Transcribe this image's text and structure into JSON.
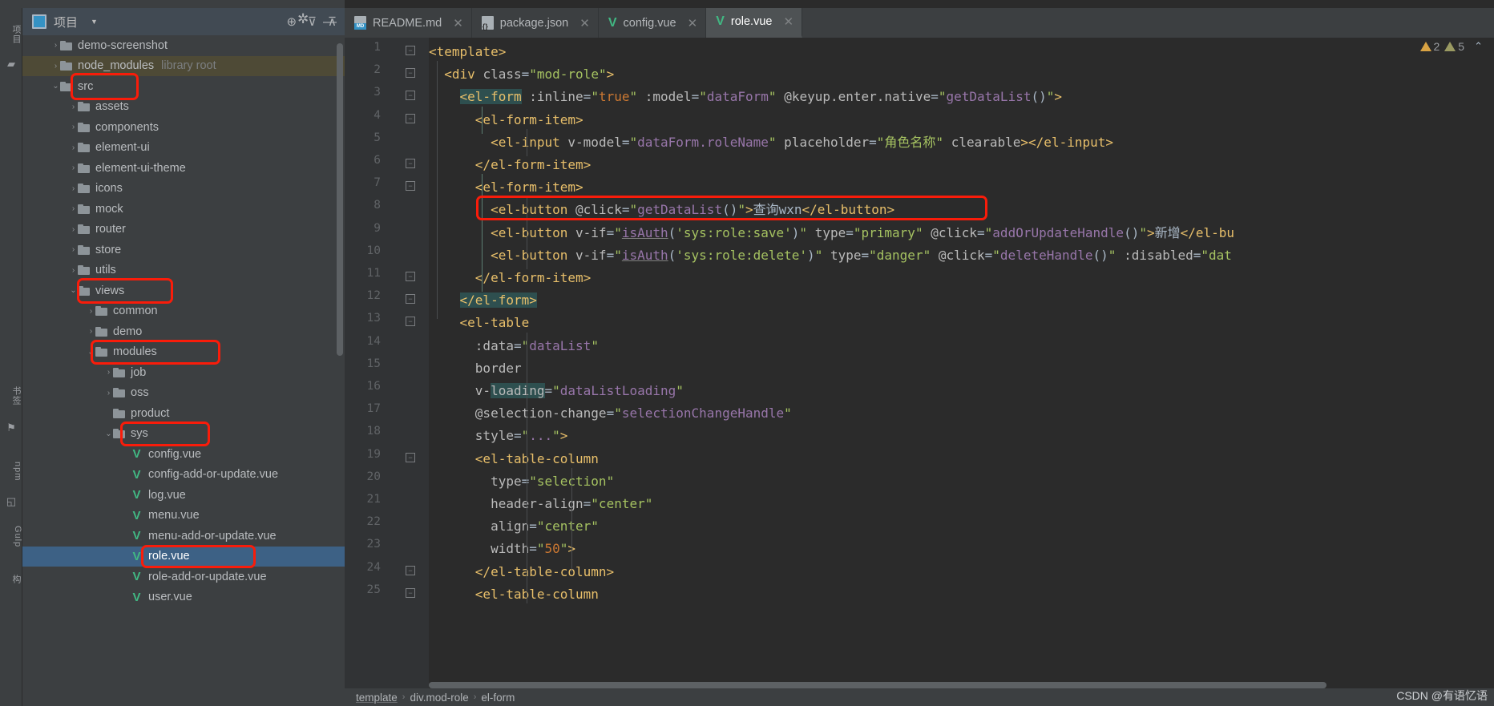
{
  "window": {
    "title": "role.vue"
  },
  "left_rail": {
    "items": [
      {
        "name": "rail-project",
        "label": "项目",
        "type": "text"
      },
      {
        "name": "rail-structure-folder",
        "label": "",
        "type": "icon",
        "icon": "folder-icon"
      },
      {
        "name": "rail-bookmarks",
        "label": "书签",
        "type": "text"
      },
      {
        "name": "rail-bookmark-icon",
        "label": "",
        "type": "icon",
        "icon": "bookmark-icon"
      },
      {
        "name": "rail-npm",
        "label": "npm",
        "type": "text"
      },
      {
        "name": "rail-terminal-icon",
        "label": "",
        "type": "icon",
        "icon": "terminal-icon"
      },
      {
        "name": "rail-gulp",
        "label": "Gulp",
        "type": "text"
      },
      {
        "name": "rail-structure",
        "label": "构",
        "type": "text"
      }
    ]
  },
  "project_panel": {
    "header": {
      "title": "项目",
      "caret": "▼",
      "tools": [
        {
          "name": "locate-icon",
          "glyph": "⊕"
        },
        {
          "name": "expand-all-icon",
          "glyph": "⊽"
        },
        {
          "name": "collapse-all-icon",
          "glyph": "⊼"
        },
        {
          "name": "settings-gear-icon",
          "glyph": "✿"
        },
        {
          "name": "minimize-icon",
          "glyph": "—"
        }
      ]
    },
    "tree": [
      {
        "label": "demo-screenshot",
        "type": "folder",
        "indent": 1,
        "arrow": "›",
        "sub": "",
        "state": "collapsed"
      },
      {
        "label": "node_modules",
        "type": "folder",
        "indent": 1,
        "arrow": "›",
        "sub": "library root",
        "state": "library"
      },
      {
        "label": "src",
        "type": "folder",
        "indent": 1,
        "arrow": "⌄",
        "sub": "",
        "state": "expanded"
      },
      {
        "label": "assets",
        "type": "folder",
        "indent": 2,
        "arrow": "›",
        "sub": "",
        "state": "collapsed"
      },
      {
        "label": "components",
        "type": "folder",
        "indent": 2,
        "arrow": "›",
        "sub": "",
        "state": "collapsed"
      },
      {
        "label": "element-ui",
        "type": "folder",
        "indent": 2,
        "arrow": "›",
        "sub": "",
        "state": "collapsed"
      },
      {
        "label": "element-ui-theme",
        "type": "folder",
        "indent": 2,
        "arrow": "›",
        "sub": "",
        "state": "collapsed"
      },
      {
        "label": "icons",
        "type": "folder",
        "indent": 2,
        "arrow": "›",
        "sub": "",
        "state": "collapsed"
      },
      {
        "label": "mock",
        "type": "folder",
        "indent": 2,
        "arrow": "›",
        "sub": "",
        "state": "collapsed"
      },
      {
        "label": "router",
        "type": "folder",
        "indent": 2,
        "arrow": "›",
        "sub": "",
        "state": "collapsed"
      },
      {
        "label": "store",
        "type": "folder",
        "indent": 2,
        "arrow": "›",
        "sub": "",
        "state": "collapsed"
      },
      {
        "label": "utils",
        "type": "folder",
        "indent": 2,
        "arrow": "›",
        "sub": "",
        "state": "collapsed"
      },
      {
        "label": "views",
        "type": "folder",
        "indent": 2,
        "arrow": "⌄",
        "sub": "",
        "state": "expanded"
      },
      {
        "label": "common",
        "type": "folder",
        "indent": 3,
        "arrow": "›",
        "sub": "",
        "state": "collapsed"
      },
      {
        "label": "demo",
        "type": "folder",
        "indent": 3,
        "arrow": "›",
        "sub": "",
        "state": "collapsed"
      },
      {
        "label": "modules",
        "type": "folder",
        "indent": 3,
        "arrow": "⌄",
        "sub": "",
        "state": "expanded"
      },
      {
        "label": "job",
        "type": "folder",
        "indent": 4,
        "arrow": "›",
        "sub": "",
        "state": "collapsed"
      },
      {
        "label": "oss",
        "type": "folder",
        "indent": 4,
        "arrow": "›",
        "sub": "",
        "state": "collapsed"
      },
      {
        "label": "product",
        "type": "folder",
        "indent": 4,
        "arrow": "",
        "sub": "",
        "state": "leaf"
      },
      {
        "label": "sys",
        "type": "folder",
        "indent": 4,
        "arrow": "⌄",
        "sub": "",
        "state": "expanded"
      },
      {
        "label": "config.vue",
        "type": "vue",
        "indent": 5,
        "arrow": "",
        "sub": "",
        "state": "file"
      },
      {
        "label": "config-add-or-update.vue",
        "type": "vue",
        "indent": 5,
        "arrow": "",
        "sub": "",
        "state": "file"
      },
      {
        "label": "log.vue",
        "type": "vue",
        "indent": 5,
        "arrow": "",
        "sub": "",
        "state": "file"
      },
      {
        "label": "menu.vue",
        "type": "vue",
        "indent": 5,
        "arrow": "",
        "sub": "",
        "state": "file"
      },
      {
        "label": "menu-add-or-update.vue",
        "type": "vue",
        "indent": 5,
        "arrow": "",
        "sub": "",
        "state": "file"
      },
      {
        "label": "role.vue",
        "type": "vue",
        "indent": 5,
        "arrow": "",
        "sub": "",
        "state": "selected"
      },
      {
        "label": "role-add-or-update.vue",
        "type": "vue",
        "indent": 5,
        "arrow": "",
        "sub": "",
        "state": "file"
      },
      {
        "label": "user.vue",
        "type": "vue",
        "indent": 5,
        "arrow": "",
        "sub": "",
        "state": "file"
      }
    ],
    "annotations": [
      {
        "name": "annotation-src",
        "target": "src"
      },
      {
        "name": "annotation-views",
        "target": "views"
      },
      {
        "name": "annotation-modules",
        "target": "modules"
      },
      {
        "name": "annotation-sys",
        "target": "sys"
      },
      {
        "name": "annotation-role-vue",
        "target": "role.vue"
      }
    ]
  },
  "tabs": [
    {
      "label": "README.md",
      "icon": "markdown-icon",
      "active": false,
      "closable": true
    },
    {
      "label": "package.json",
      "icon": "json-icon",
      "active": false,
      "closable": true
    },
    {
      "label": "config.vue",
      "icon": "vue-icon",
      "active": false,
      "closable": true
    },
    {
      "label": "role.vue",
      "icon": "vue-icon",
      "active": true,
      "closable": true
    }
  ],
  "inspections": {
    "warnings": "2",
    "weak_warnings": "5",
    "collapse_glyph": "⌃"
  },
  "breadcrumb": [
    "template",
    "div.mod-role",
    "el-form"
  ],
  "watermark": "CSDN @有语忆语",
  "editor": {
    "annotation_line": 8,
    "lines": [
      {
        "n": 1,
        "indent": 0,
        "fold": "minus",
        "html": "<span class=\"tag\">&lt;template&gt;</span>"
      },
      {
        "n": 2,
        "indent": 1,
        "fold": "minus",
        "html": "  <span class=\"tag\">&lt;div</span> <span class=\"attr\">class</span><span class=\"punct\">=</span><span class=\"str\">\"mod-role\"</span><span class=\"tag\">&gt;</span>"
      },
      {
        "n": 3,
        "indent": 2,
        "fold": "minus",
        "html": "    <span class=\"tag hl\">&lt;el-form</span> <span class=\"attr\">:inline</span><span class=\"punct\">=</span><span class=\"str\">\"</span><span class=\"val-o\">true</span><span class=\"str\">\"</span> <span class=\"attr\">:model</span><span class=\"punct\">=</span><span class=\"str\">\"</span><span class=\"val-p\">dataForm</span><span class=\"str\">\"</span> <span class=\"attr\">@keyup.enter.native</span><span class=\"punct\">=</span><span class=\"str\">\"</span><span class=\"val-p\">getDataList</span><span class=\"punct\">()</span><span class=\"str\">\"</span><span class=\"tag\">&gt;</span>"
      },
      {
        "n": 4,
        "indent": 3,
        "fold": "minus",
        "html": "      <span class=\"tag\">&lt;el-form-item&gt;</span>"
      },
      {
        "n": 5,
        "indent": 4,
        "fold": "",
        "html": "        <span class=\"tag\">&lt;el-input</span> <span class=\"attr\">v-model</span><span class=\"punct\">=</span><span class=\"str\">\"</span><span class=\"val-p\">dataForm.roleName</span><span class=\"str\">\"</span> <span class=\"attr\">placeholder</span><span class=\"punct\">=</span><span class=\"str\">\"角色名称\"</span> <span class=\"attr\">clearable</span><span class=\"tag\">&gt;&lt;/el-input&gt;</span>"
      },
      {
        "n": 6,
        "indent": 3,
        "fold": "plus",
        "html": "      <span class=\"tag\">&lt;/el-form-item&gt;</span>"
      },
      {
        "n": 7,
        "indent": 3,
        "fold": "minus",
        "html": "      <span class=\"tag\">&lt;el-form-item&gt;</span>"
      },
      {
        "n": 8,
        "indent": 4,
        "fold": "",
        "html": "        <span class=\"tag\">&lt;el-button</span> <span class=\"attr\">@click</span><span class=\"punct\">=</span><span class=\"str\">\"</span><span class=\"val-p\">getDataList</span><span class=\"punct\">()</span><span class=\"str\">\"</span><span class=\"tag\">&gt;</span><span class=\"punct\">查询wxn</span><span class=\"tag\">&lt;/el-button&gt;</span>"
      },
      {
        "n": 9,
        "indent": 4,
        "fold": "",
        "html": "        <span class=\"tag\">&lt;el-button</span> <span class=\"attr\">v-if</span><span class=\"punct\">=</span><span class=\"str\">\"</span><span class=\"val-p ul\">isAuth</span><span class=\"punct\">(</span><span class=\"str\">'sys:role:save'</span><span class=\"punct\">)</span><span class=\"str\">\"</span> <span class=\"attr\">type</span><span class=\"punct\">=</span><span class=\"str\">\"primary\"</span> <span class=\"attr\">@click</span><span class=\"punct\">=</span><span class=\"str\">\"</span><span class=\"val-p\">addOrUpdateHandle</span><span class=\"punct\">()</span><span class=\"str\">\"</span><span class=\"tag\">&gt;</span><span class=\"punct\">新增</span><span class=\"tag\">&lt;/el-bu</span>"
      },
      {
        "n": 10,
        "indent": 4,
        "fold": "",
        "html": "        <span class=\"tag\">&lt;el-button</span> <span class=\"attr\">v-if</span><span class=\"punct\">=</span><span class=\"str\">\"</span><span class=\"val-p ul\">isAuth</span><span class=\"punct\">(</span><span class=\"str\">'sys:role:delete'</span><span class=\"punct\">)</span><span class=\"str\">\"</span> <span class=\"attr\">type</span><span class=\"punct\">=</span><span class=\"str\">\"danger\"</span> <span class=\"attr\">@click</span><span class=\"punct\">=</span><span class=\"str\">\"</span><span class=\"val-p\">deleteHandle</span><span class=\"punct\">()</span><span class=\"str\">\"</span> <span class=\"attr\">:disabled</span><span class=\"punct\">=</span><span class=\"str\">\"dat</span>"
      },
      {
        "n": 11,
        "indent": 3,
        "fold": "plus",
        "html": "      <span class=\"tag\">&lt;/el-form-item&gt;</span>"
      },
      {
        "n": 12,
        "indent": 2,
        "fold": "plus",
        "html": "    <span class=\"tag hl\">&lt;/el-form&gt;</span>"
      },
      {
        "n": 13,
        "indent": 2,
        "fold": "minus",
        "html": "    <span class=\"tag\">&lt;el-table</span>"
      },
      {
        "n": 14,
        "indent": 3,
        "fold": "",
        "html": "      <span class=\"attr\">:data</span><span class=\"punct\">=</span><span class=\"str\">\"</span><span class=\"val-p\">dataList</span><span class=\"str\">\"</span>"
      },
      {
        "n": 15,
        "indent": 3,
        "fold": "",
        "html": "      <span class=\"attr\">border</span>"
      },
      {
        "n": 16,
        "indent": 3,
        "fold": "",
        "html": "      <span class=\"attr\">v-</span><span class=\"attr hl\">loading</span><span class=\"punct\">=</span><span class=\"str\">\"</span><span class=\"val-p\">dataListLoading</span><span class=\"str\">\"</span>"
      },
      {
        "n": 17,
        "indent": 3,
        "fold": "",
        "html": "      <span class=\"attr\">@selection-change</span><span class=\"punct\">=</span><span class=\"str\">\"</span><span class=\"val-p\">selectionChangeHandle</span><span class=\"str\">\"</span>"
      },
      {
        "n": 18,
        "indent": 3,
        "fold": "",
        "html": "      <span class=\"attr\">style</span><span class=\"punct\">=</span><span class=\"str\">\"</span><span class=\"val-p\">...</span><span class=\"str\">\"</span><span class=\"tag\">&gt;</span>"
      },
      {
        "n": 19,
        "indent": 3,
        "fold": "minus",
        "html": "      <span class=\"tag\">&lt;el-table-column</span>"
      },
      {
        "n": 20,
        "indent": 4,
        "fold": "",
        "html": "        <span class=\"attr\">type</span><span class=\"punct\">=</span><span class=\"str\">\"selection\"</span>"
      },
      {
        "n": 21,
        "indent": 4,
        "fold": "",
        "html": "        <span class=\"attr\">header-align</span><span class=\"punct\">=</span><span class=\"str\">\"center\"</span>"
      },
      {
        "n": 22,
        "indent": 4,
        "fold": "",
        "html": "        <span class=\"attr\">align</span><span class=\"punct\">=</span><span class=\"str\">\"center\"</span>"
      },
      {
        "n": 23,
        "indent": 4,
        "fold": "",
        "html": "        <span class=\"attr\">width</span><span class=\"punct\">=</span><span class=\"str\">\"</span><span class=\"val-o\">50</span><span class=\"str\">\"</span><span class=\"tag\">&gt;</span>"
      },
      {
        "n": 24,
        "indent": 3,
        "fold": "plus",
        "html": "      <span class=\"tag\">&lt;/el-table-column&gt;</span>"
      },
      {
        "n": 25,
        "indent": 3,
        "fold": "minus",
        "html": "      <span class=\"tag\">&lt;el-table-column</span>"
      }
    ]
  },
  "colors": {
    "accent": "#3592c4",
    "annotation": "#f91c0a",
    "vue_green": "#41b883",
    "selection": "#3d6185",
    "library_bg": "#4e4a36"
  }
}
